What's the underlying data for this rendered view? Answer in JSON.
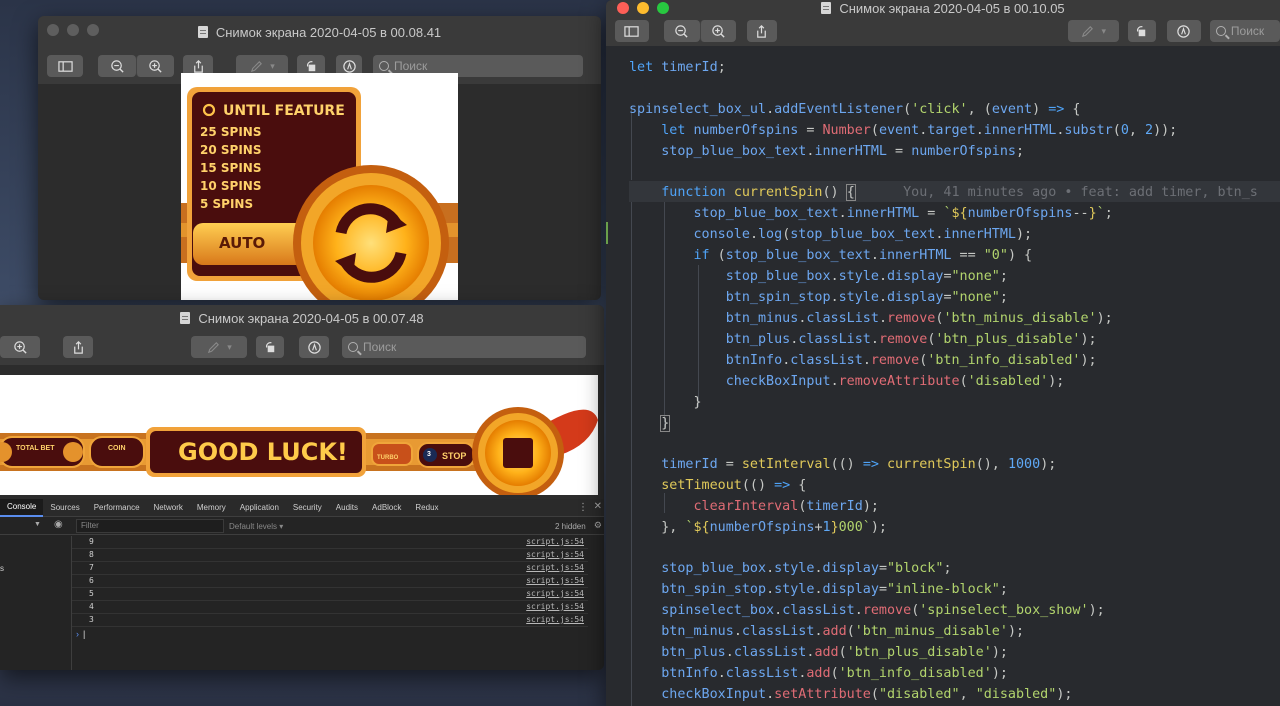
{
  "preview_top": {
    "title": "Снимок экрана 2020-04-05 в 00.08.41",
    "search_placeholder": "Поиск",
    "game_panel": {
      "header": "UNTIL FEATURE",
      "spins": [
        "25 SPINS",
        "20 SPINS",
        "15 SPINS",
        "10 SPINS",
        "5 SPINS"
      ],
      "auto_label": "AUTO"
    }
  },
  "preview_bottom": {
    "title": "Снимок экрана 2020-04-05 в 00.07.48",
    "search_placeholder": "Поиск",
    "game_bar": {
      "total_bet": "TOTAL BET",
      "coin": "COIN",
      "banner": "GOOD LUCK!",
      "turbo": "TURBO",
      "stop_count": "3",
      "stop": "STOP"
    }
  },
  "devtools": {
    "tabs": [
      "Console",
      "Sources",
      "Performance",
      "Network",
      "Memory",
      "Application",
      "Security",
      "Audits",
      "AdBlock",
      "Redux"
    ],
    "filter_placeholder": "Filter",
    "levels": "Default levels ▾",
    "hidden": "2 hidden",
    "sidebar_text": "s",
    "rows": [
      {
        "value": "9",
        "source": "script.js:54"
      },
      {
        "value": "8",
        "source": "script.js:54"
      },
      {
        "value": "7",
        "source": "script.js:54"
      },
      {
        "value": "6",
        "source": "script.js:54"
      },
      {
        "value": "5",
        "source": "script.js:54"
      },
      {
        "value": "4",
        "source": "script.js:54"
      },
      {
        "value": "3",
        "source": "script.js:54"
      }
    ]
  },
  "editor": {
    "title": "Снимок экрана 2020-04-05 в 00.10.05",
    "search_placeholder": "Поиск",
    "blame": "You, 41 minutes ago • feat: add timer, btn_s"
  },
  "colors": {
    "keyword": "#4fa3f7",
    "function": "#e0c95a",
    "string": "#b2d46d",
    "number": "#5fa8f5"
  }
}
